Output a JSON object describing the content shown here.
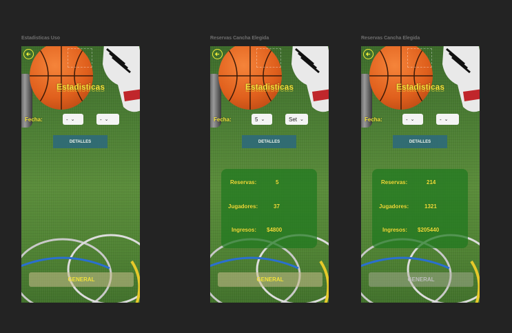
{
  "frames": [
    {
      "label": "Estadisticas Uso",
      "title": "Estadisticas",
      "fecha_label": "Fecha:",
      "select1": "-",
      "select2": "-",
      "detalles": "DETALLES",
      "general": "GENERAL",
      "stats": null
    },
    {
      "label": "Reservas Cancha Elegida",
      "title": "Estadisticas",
      "fecha_label": "Fecha:",
      "select1": "5",
      "select2": "Set",
      "detalles": "DETALLES",
      "general": "GENERAL",
      "stats": {
        "reservas_label": "Reservas:",
        "reservas": "5",
        "jugadores_label": "Jugadores:",
        "jugadores": "37",
        "ingresos_label": "Ingresos:",
        "ingresos": "$4800"
      }
    },
    {
      "label": "Reservas Cancha Elegida",
      "title": "Estadisticas",
      "fecha_label": "Fecha:",
      "select1": "-",
      "select2": "-",
      "detalles": "DETALLES",
      "general": "GENERAL",
      "stats": {
        "reservas_label": "Reservas:",
        "reservas": "214",
        "jugadores_label": "Jugadores:",
        "jugadores": "1321",
        "ingresos_label": "Ingresos:",
        "ingresos": "$205440"
      }
    }
  ],
  "colors": {
    "accent": "#f2e23a",
    "detalles_bg": "#2f6b78",
    "stats_bg": "#1e781e",
    "canvas": "#232323"
  },
  "icons": {
    "back": "arrow-left-circle-icon",
    "dropdown": "chevron-down-icon"
  }
}
